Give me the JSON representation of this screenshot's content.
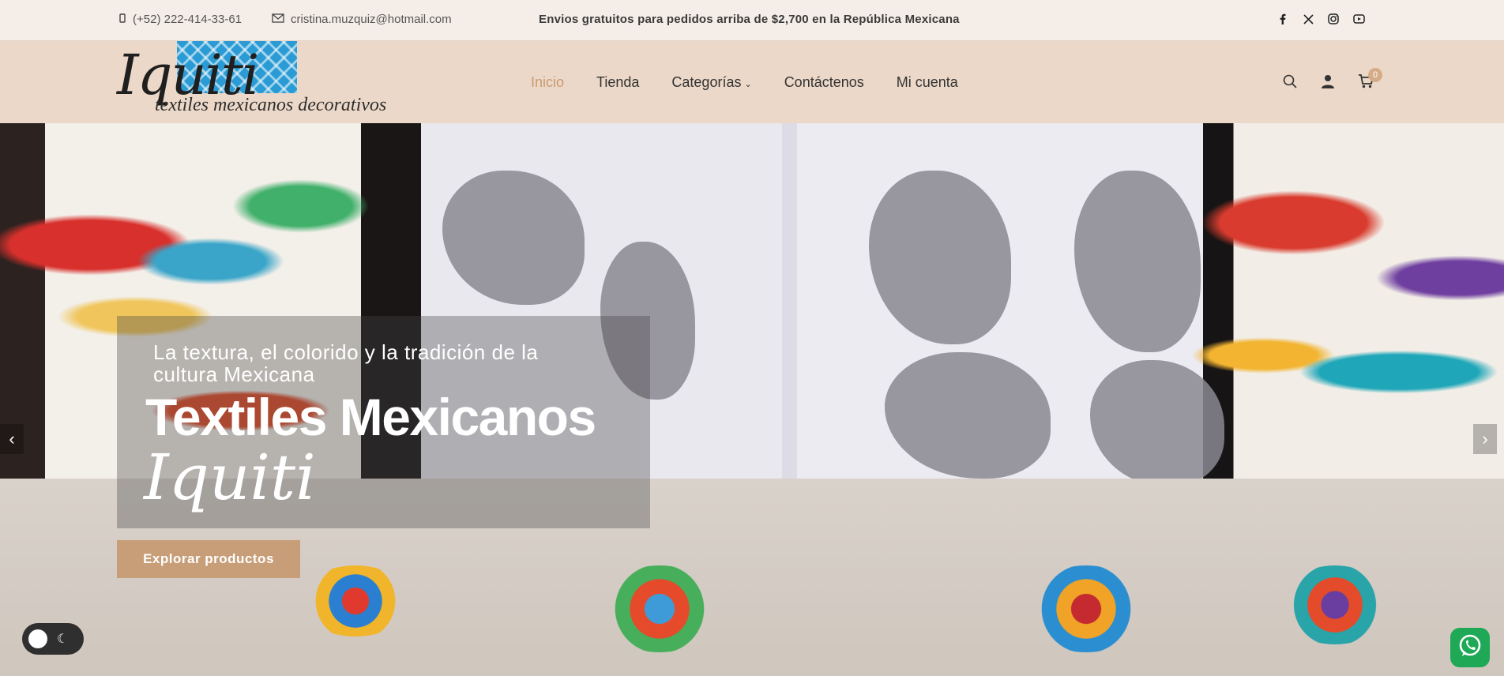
{
  "topbar": {
    "phone": "(+52) 222-414-33-61",
    "email": "cristina.muzquiz@hotmail.com",
    "notice": "Envios gratuitos para pedidos arriba de $2,700 en la República Mexicana",
    "social_icons": [
      "facebook-icon",
      "x-icon",
      "instagram-icon",
      "youtube-icon"
    ]
  },
  "brand": {
    "logo_script": "Iquiti",
    "tagline": "textiles mexicanos decorativos"
  },
  "nav": {
    "items": [
      "Inicio",
      "Tienda",
      "Categorías",
      "Contáctenos",
      "Mi cuenta"
    ],
    "active": "Inicio"
  },
  "header": {
    "cart_count": "0",
    "icons": [
      "search-icon",
      "user-icon",
      "cart-icon"
    ]
  },
  "hero": {
    "subtitle": "La textura, el colorido y la tradición de la cultura Mexicana",
    "title": "Textiles Mexicanos",
    "script": "Iquiti",
    "cta": "Explorar productos"
  },
  "colors": {
    "accent": "#c99a72",
    "button": "#c79e77",
    "header_bg": "#ecd8c8",
    "topbar_bg": "#f5eee8",
    "whatsapp": "#1fa855"
  }
}
